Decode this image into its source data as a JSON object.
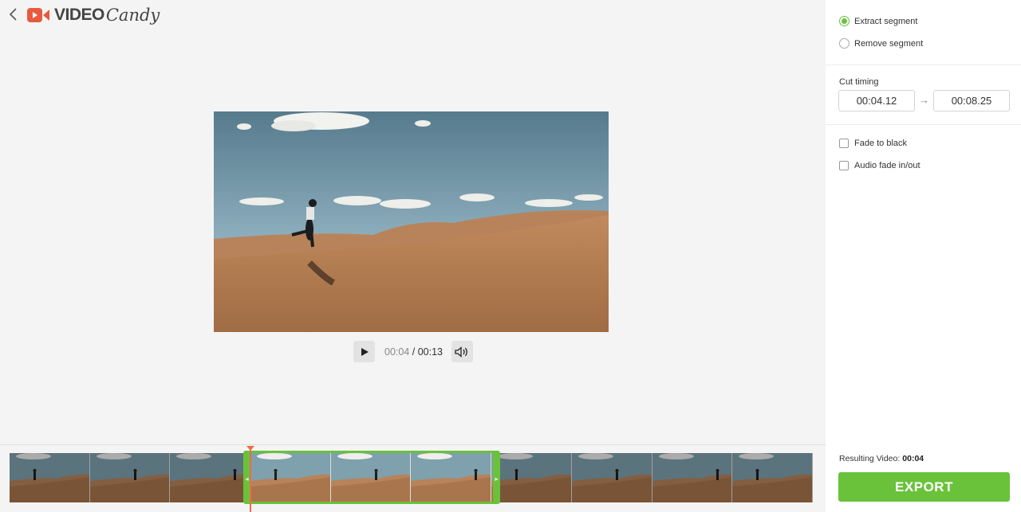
{
  "header": {
    "logo_video": "VIDEO",
    "logo_candy": "Candy",
    "back_icon": "chevron-left-icon",
    "logo_icon": "video-camera-icon"
  },
  "player": {
    "current_time": "00:04",
    "separator": " / ",
    "total_time": "00:13",
    "play_icon": "play-icon",
    "volume_icon": "volume-icon"
  },
  "panel": {
    "mode_options": [
      {
        "label": "Extract segment",
        "checked": true
      },
      {
        "label": "Remove segment",
        "checked": false
      }
    ],
    "cut_timing_label": "Cut timing",
    "cut_start": "00:04.12",
    "cut_arrow": "→",
    "cut_end": "00:08.25",
    "options": [
      {
        "label": "Fade to black",
        "checked": false
      },
      {
        "label": "Audio fade in/out",
        "checked": false
      }
    ],
    "resulting_label": "Resulting Video:",
    "resulting_value": "00:04",
    "export_label": "EXPORT"
  },
  "timeline": {
    "thumbnail_count": 10,
    "selection_start": 0.317,
    "selection_end": 0.635,
    "playhead_position": 0.317
  },
  "colors": {
    "accent_green": "#6ac23b",
    "playhead": "#f26a4b",
    "logo_red": "#e85a3e"
  }
}
